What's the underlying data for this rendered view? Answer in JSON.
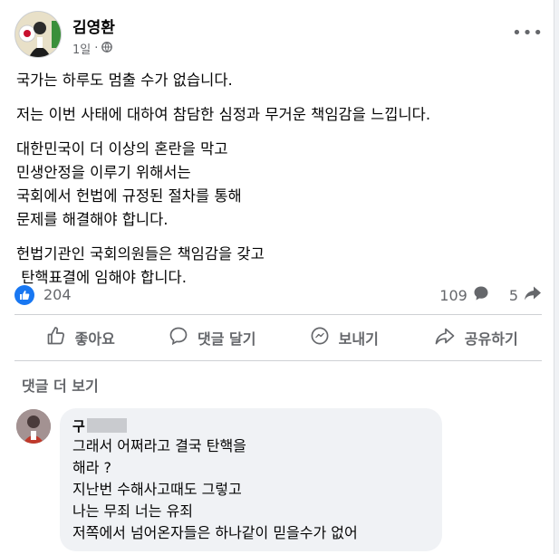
{
  "post": {
    "author": "김영환",
    "time": "1일",
    "paragraphs": [
      [
        "국가는 하루도 멈출 수가 없습니다."
      ],
      [
        "저는 이번 사태에 대하여 참담한 심정과 무거운 책임감을 느낍니다."
      ],
      [
        "대한민국이 더 이상의 혼란을 막고",
        "민생안정을 이루기 위해서는",
        "국회에서 헌법에 규정된 절차를 통해",
        "문제를 해결해야 합니다."
      ],
      [
        "헌법기관인 국회의원들은 책임감을 갖고",
        " 탄핵표결에 임해야 합니다."
      ]
    ]
  },
  "stats": {
    "likes": "204",
    "comments": "109",
    "shares": "5"
  },
  "actions": {
    "like": "좋아요",
    "comment": "댓글 달기",
    "send": "보내기",
    "share": "공유하기"
  },
  "more_comments": "댓글 더 보기",
  "comment": {
    "author": "구",
    "lines": [
      "그래서 어쩌라고 결국 탄핵을",
      "해라 ?",
      "지난번 수해사고때도 그렇고",
      "나는 무죄 너는 유죄",
      "저쪽에서 넘어온자들은 하나같이 믿을수가 없어"
    ]
  },
  "colors": {
    "accent": "#1877f2",
    "secondary_text": "#65676b",
    "bubble": "#f0f2f5"
  }
}
